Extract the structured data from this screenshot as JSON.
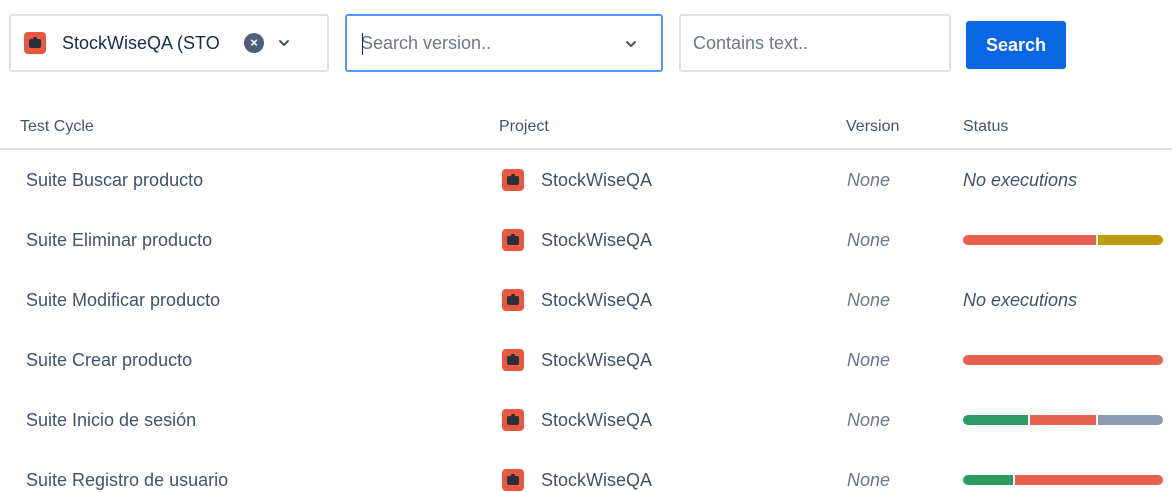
{
  "filters": {
    "project": {
      "value": "StockWiseQA (STO",
      "icon": "project-briefcase-icon"
    },
    "version": {
      "placeholder": "Search version..",
      "value": ""
    },
    "text": {
      "placeholder": "Contains text..",
      "value": ""
    },
    "search_label": "Search"
  },
  "colors": {
    "fail": "#e5604e",
    "wip": "#bf9a06",
    "pass": "#2e9b63",
    "unexecuted": "#8f9bb3",
    "accent": "#0b66e4"
  },
  "table": {
    "headers": {
      "test_cycle": "Test Cycle",
      "project": "Project",
      "version": "Version",
      "status": "Status"
    },
    "rows": [
      {
        "cycle": "Suite Buscar producto",
        "project": "StockWiseQA",
        "version": "None",
        "status_text": "No executions",
        "segments": []
      },
      {
        "cycle": "Suite Eliminar producto",
        "project": "StockWiseQA",
        "version": "None",
        "status_text": "",
        "segments": [
          {
            "status": "fail",
            "fraction": 0.67
          },
          {
            "status": "wip",
            "fraction": 0.33
          }
        ]
      },
      {
        "cycle": "Suite Modificar producto",
        "project": "StockWiseQA",
        "version": "None",
        "status_text": "No executions",
        "segments": []
      },
      {
        "cycle": "Suite Crear producto",
        "project": "StockWiseQA",
        "version": "None",
        "status_text": "",
        "segments": [
          {
            "status": "fail",
            "fraction": 1.0
          }
        ]
      },
      {
        "cycle": "Suite Inicio de sesión",
        "project": "StockWiseQA",
        "version": "None",
        "status_text": "",
        "segments": [
          {
            "status": "pass",
            "fraction": 0.33
          },
          {
            "status": "fail",
            "fraction": 0.34
          },
          {
            "status": "unexecuted",
            "fraction": 0.33
          }
        ]
      },
      {
        "cycle": "Suite Registro de usuario",
        "project": "StockWiseQA",
        "version": "None",
        "status_text": "",
        "segments": [
          {
            "status": "pass",
            "fraction": 0.25
          },
          {
            "status": "fail",
            "fraction": 0.75
          }
        ]
      }
    ]
  }
}
